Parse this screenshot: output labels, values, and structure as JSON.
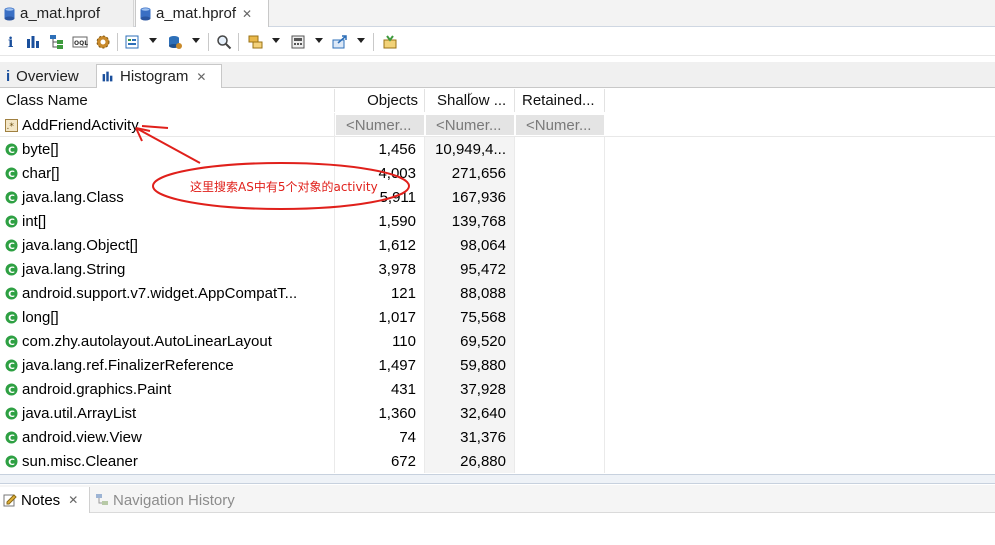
{
  "editor_tabs": [
    {
      "label": "a_mat.hprof",
      "active": false
    },
    {
      "label": "a_mat.hprof",
      "active": true
    }
  ],
  "toolbar": {
    "icons": [
      "info-icon",
      "histogram-icon",
      "dominator-tree-icon",
      "oql-icon",
      "gear-icon",
      "report-icon",
      "query-browser-icon",
      "search-icon",
      "group-icon",
      "calculate-icon",
      "export-icon",
      "pin-icon"
    ]
  },
  "view_tabs": [
    {
      "label": "Overview",
      "icon": "info-icon",
      "active": false
    },
    {
      "label": "Histogram",
      "icon": "histogram-icon",
      "active": true
    }
  ],
  "table": {
    "columns": [
      "Class Name",
      "Objects",
      "Shallow ...",
      "Retained..."
    ],
    "filter_row": {
      "class_name": "AddFriendActivity",
      "objects_placeholder": "<Numer...",
      "shallow_placeholder": "<Numer...",
      "retained_placeholder": "<Numer..."
    },
    "rows": [
      {
        "name": "byte[]",
        "objects": "1,456",
        "shallow": "10,949,4..."
      },
      {
        "name": "char[]",
        "objects": "4,003",
        "shallow": "271,656"
      },
      {
        "name": "java.lang.Class",
        "objects": "5,911",
        "shallow": "167,936"
      },
      {
        "name": "int[]",
        "objects": "1,590",
        "shallow": "139,768"
      },
      {
        "name": "java.lang.Object[]",
        "objects": "1,612",
        "shallow": "98,064"
      },
      {
        "name": "java.lang.String",
        "objects": "3,978",
        "shallow": "95,472"
      },
      {
        "name": "android.support.v7.widget.AppCompatT...",
        "objects": "121",
        "shallow": "88,088"
      },
      {
        "name": "long[]",
        "objects": "1,017",
        "shallow": "75,568"
      },
      {
        "name": "com.zhy.autolayout.AutoLinearLayout",
        "objects": "110",
        "shallow": "69,520"
      },
      {
        "name": "java.lang.ref.FinalizerReference",
        "objects": "1,497",
        "shallow": "59,880"
      },
      {
        "name": "android.graphics.Paint",
        "objects": "431",
        "shallow": "37,928"
      },
      {
        "name": "java.util.ArrayList",
        "objects": "1,360",
        "shallow": "32,640"
      },
      {
        "name": "android.view.View",
        "objects": "74",
        "shallow": "31,376"
      },
      {
        "name": "sun.misc.Cleaner",
        "objects": "672",
        "shallow": "26,880"
      }
    ]
  },
  "annotation": {
    "text": "这里搜索AS中有5个对象的activity",
    "color": "#e0201b"
  },
  "bottom_tabs": [
    {
      "label": "Notes",
      "active": true
    },
    {
      "label": "Navigation History",
      "active": false
    }
  ],
  "colors": {
    "class_icon": "#2ea043",
    "accent": "#1a4f9c"
  }
}
